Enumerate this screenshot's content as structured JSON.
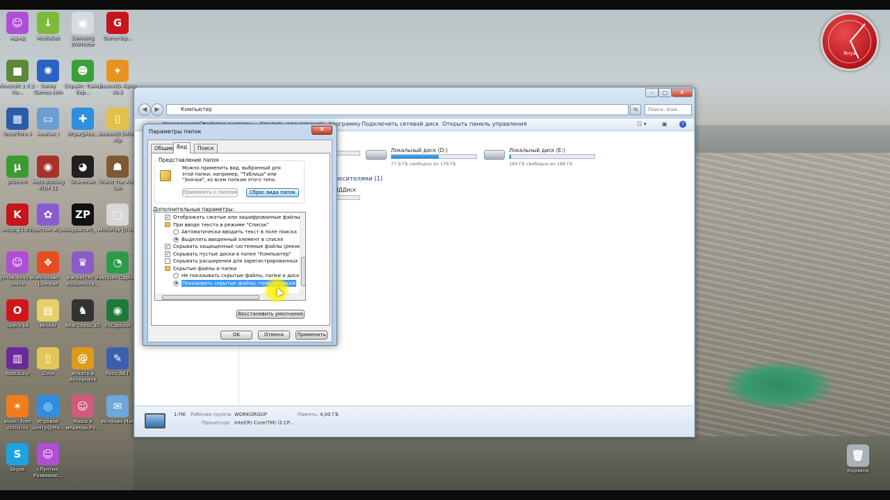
{
  "desktop": {
    "icons": [
      {
        "label": "жджд",
        "color": "#b04fd6",
        "glyph": "☺"
      },
      {
        "label": "MediaGet",
        "color": "#7fb93a",
        "glyph": "↓"
      },
      {
        "label": "Samsung DVPrinter",
        "color": "#d7dbe0",
        "glyph": "▣"
      },
      {
        "label": "Game-Top...",
        "color": "#c8141b",
        "glyph": "G"
      },
      {
        "label": "Minecraft 1.7.2 - Ru...",
        "color": "#5d8a3a",
        "glyph": "■"
      },
      {
        "label": "Sonny Games.com",
        "color": "#2a63c2",
        "glyph": "✺"
      },
      {
        "label": "Спрайт: Тайна бер...",
        "color": "#3aa03a",
        "glyph": "☻"
      },
      {
        "label": "BeamNG Alpha v0.3",
        "color": "#e8931f",
        "glyph": "✦"
      },
      {
        "label": "SmarThru 4",
        "color": "#2a5ca8",
        "glyph": "▦"
      },
      {
        "label": "компик )",
        "color": "#6a9ed1",
        "glyph": "▭"
      },
      {
        "label": "Игры@Mai...",
        "color": "#2f8ee0",
        "glyph": "✚"
      },
      {
        "label": "BeamNG DRIVE Alp",
        "color": "#e3c04a",
        "glyph": "▯"
      },
      {
        "label": "µTorrent",
        "color": "#3b9b30",
        "glyph": "µ"
      },
      {
        "label": "Nero Burning ROM 11",
        "color": "#a8322b",
        "glyph": "◉"
      },
      {
        "label": "Shareman",
        "color": "#202020",
        "glyph": "◕"
      },
      {
        "label": "Grand The Auto San",
        "color": "#7d5a33",
        "glyph": "☗"
      },
      {
        "label": "setup_11.0...",
        "color": "#c6141b",
        "glyph": "K"
      },
      {
        "label": "Простые игры",
        "color": "#8c5bd1",
        "glyph": "✿"
      },
      {
        "label": "zuppacraft_...",
        "color": "#111111",
        "glyph": "ZP"
      },
      {
        "label": "MultiPlay [0.3e]",
        "color": "#d8d8d8",
        "glyph": "□"
      },
      {
        "label": "Лунтик.Хочу все знать",
        "color": "#b04fd6",
        "glyph": "☺"
      },
      {
        "label": "Windows Live.exe",
        "color": "#e84d1f",
        "glyph": "❖"
      },
      {
        "label": "Barbie(TM) и Волшебств...",
        "color": "#8a5cc8",
        "glyph": "♛"
      },
      {
        "label": "FastSton Capture",
        "color": "#2b9b4b",
        "glyph": "◔"
      },
      {
        "label": "Opera 18",
        "color": "#d2141b",
        "glyph": "O"
      },
      {
        "label": "MineAl",
        "color": "#e4cf6a",
        "glyph": "▤"
      },
      {
        "label": "Real Chess 3D",
        "color": "#333333",
        "glyph": "♞"
      },
      {
        "label": "FSCapture",
        "color": "#1f7a3a",
        "glyph": "◉"
      },
      {
        "label": "Nodus.zip",
        "color": "#6a2b9a",
        "glyph": "▥"
      },
      {
        "label": "Zona",
        "color": "#e2c65a",
        "glyph": "▯"
      },
      {
        "label": "Искать в Интернете",
        "color": "#e09a1a",
        "glyph": "@"
      },
      {
        "label": "Paint.NET",
        "color": "#3b5fb0",
        "glyph": "✎"
      },
      {
        "label": "avast! Free Antivirus",
        "color": "#f07d1a",
        "glyph": "✶"
      },
      {
        "label": "Игровой центр@Ma...",
        "color": "#2f8ee0",
        "glyph": "◎"
      },
      {
        "label": "Маша и медведь.Ра...",
        "color": "#d25a7a",
        "glyph": "☺"
      },
      {
        "label": "Windows Mail",
        "color": "#6ea7d9",
        "glyph": "✉"
      },
      {
        "label": "Skype",
        "color": "#1ea2e6",
        "glyph": "S"
      },
      {
        "label": "«Лунтик. Развиваю...",
        "color": "#b04fd6",
        "glyph": "☺"
      },
      {
        "label": "Корзина",
        "color": "#aab2b8",
        "glyph": "🗑"
      }
    ],
    "clock_label": "Януа"
  },
  "explorer": {
    "address": "Компьютер",
    "search_placeholder": "Поиск: Ком...",
    "toolbar": {
      "organize": "Упорядочить ▾",
      "system_properties": "Свойства системы",
      "uninstall": "Удалить или изменить программу",
      "map_drive": "Подключить сетевой диск",
      "control_panel": "Открыть панель управления"
    },
    "drives": [
      {
        "name": "Локальный диск (D:)",
        "free": "77,9 ГБ свободно из 179 ГБ",
        "used_fraction": 0.56
      },
      {
        "name": "Локальный диск (E:)",
        "free": "184 ГБ свободно из 188 ГБ",
        "used_fraction": 0.02
      }
    ],
    "removable_header": "носителями (1)",
    "removable_item": "DВДДиск",
    "status": {
      "pc_name": "1-ПК",
      "workgroup_key": "Рабочая группа:",
      "workgroup_val": "WORKGROUP",
      "memory_key": "Память:",
      "memory_val": "4,00 ГБ",
      "cpu_key": "Процессор:",
      "cpu_val": "Intel(R) Core(TM) i3 CP..."
    }
  },
  "dialog": {
    "title": "Параметры папок",
    "close": "✕",
    "tabs": [
      "Общие",
      "Вид",
      "Поиск"
    ],
    "folder_views": {
      "title": "Представление папок",
      "desc": "Можно применить вид, выбранный для этой папки, например, \"Таблица\" или \"Значки\", ко всем папкам этого типа.",
      "apply_btn": "Применить к папкам",
      "reset_btn": "Сброс вида папок"
    },
    "advanced_title": "Дополнительные параметры:",
    "tree": [
      {
        "type": "checkbox",
        "checked": true,
        "indent": 0,
        "text": "Отображать сжатые или зашифрованные файлы NTFS"
      },
      {
        "type": "folder",
        "indent": 0,
        "text": "При вводе текста в режиме \"Список\""
      },
      {
        "type": "radio",
        "checked": false,
        "indent": 1,
        "text": "Автоматически вводить текст в поле поиска"
      },
      {
        "type": "radio",
        "checked": true,
        "indent": 1,
        "text": "Выделять введенный элемент в списке"
      },
      {
        "type": "checkbox",
        "checked": true,
        "indent": 0,
        "text": "Скрывать защищенные системные файлы (рекомендуется)"
      },
      {
        "type": "checkbox",
        "checked": true,
        "indent": 0,
        "text": "Скрывать пустые диски в папке \"Компьютер\""
      },
      {
        "type": "checkbox",
        "checked": false,
        "indent": 0,
        "text": "Скрывать расширения для зарегистрированных типов"
      },
      {
        "type": "folder",
        "indent": 0,
        "text": "Скрытые файлы и папки"
      },
      {
        "type": "radio",
        "checked": false,
        "indent": 1,
        "text": "Не показывать скрытые файлы, папки и диски"
      },
      {
        "type": "radio",
        "checked": true,
        "indent": 1,
        "text": "Показывать скрытые файлы, папки и диски",
        "selected": true
      }
    ],
    "restore_btn": "Восстановить умолчания",
    "ok_btn": "OK",
    "cancel_btn": "Отмена",
    "apply_btn": "Применить"
  }
}
